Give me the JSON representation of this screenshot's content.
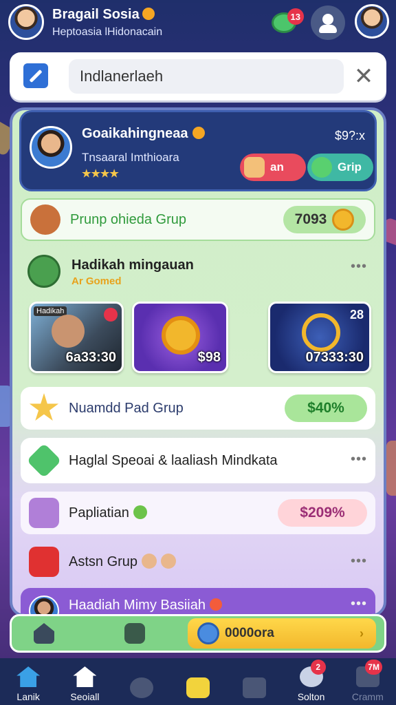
{
  "header": {
    "user_name": "Bragail Sosia",
    "user_subtitle": "Heptoasia lHidonacain",
    "chat_badge": "13"
  },
  "search": {
    "value": "Indlanerlaeh"
  },
  "group": {
    "title": "Goaikahingneaa",
    "amount": "$9?:x",
    "subtitle": "Tnsaaral Imthioara",
    "stars": "★★★★",
    "join_label": "an",
    "grup_label": "Grip"
  },
  "rows": {
    "promo": {
      "label": "Prunp ohieda Grup",
      "value": "7093"
    },
    "section": {
      "title": "Hadikah mingauan",
      "subtitle": "Ar Gomed",
      "more": "•••"
    },
    "cards": [
      {
        "tag": "Hadikah",
        "label": "6a33:30"
      },
      {
        "label": "$98"
      },
      {
        "num": "28",
        "label": "07333:30"
      }
    ],
    "group_row": {
      "label": "Nuamdd Pad Grup",
      "value": "$40%"
    },
    "special": {
      "label": "Haglal Speoai & laaliash Mindkata",
      "more": "•••"
    },
    "paplia": {
      "label": "Papliatian",
      "value": "$209%"
    },
    "astsn": {
      "label": "Astsn Grup",
      "more": "•••"
    },
    "hadiah": {
      "label": "Haadiah Mimy Basiiah",
      "more": "•••"
    }
  },
  "action_bar": {
    "coins": "0000ora",
    "arrow": "›"
  },
  "nav": {
    "items": [
      {
        "label": "Lanik",
        "icon": "home-icon"
      },
      {
        "label": "Seoiall",
        "icon": "house-icon"
      },
      {
        "label": "",
        "icon": "gear-icon"
      },
      {
        "label": "",
        "icon": "trophy-icon"
      },
      {
        "label": "",
        "icon": "ticket-icon"
      },
      {
        "label": "Solton",
        "icon": "support-icon"
      },
      {
        "label": "Cramm",
        "icon": "shop-icon"
      }
    ],
    "badge_solton": "2",
    "badge_cramm": "7M"
  }
}
